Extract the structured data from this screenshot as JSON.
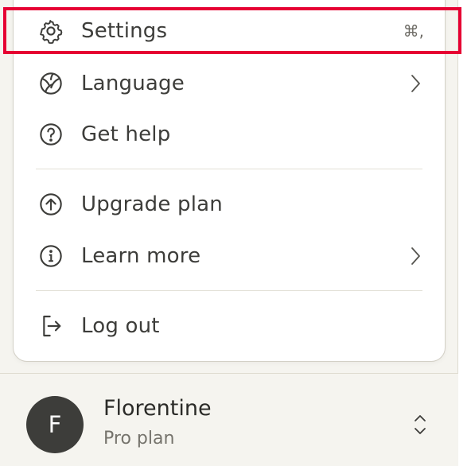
{
  "menu": {
    "settings": {
      "label": "Settings",
      "icon": "gear-icon",
      "shortcut": "⌘,"
    },
    "language": {
      "label": "Language",
      "icon": "globe-icon",
      "chevron": "chevron-right-icon"
    },
    "get_help": {
      "label": "Get help",
      "icon": "question-circle-icon"
    },
    "upgrade_plan": {
      "label": "Upgrade plan",
      "icon": "arrow-up-circle-icon"
    },
    "learn_more": {
      "label": "Learn more",
      "icon": "info-circle-icon",
      "chevron": "chevron-right-icon"
    },
    "log_out": {
      "label": "Log out",
      "icon": "logout-icon"
    }
  },
  "user": {
    "avatar_initial": "F",
    "name": "Florentine",
    "plan": "Pro plan",
    "switcher_icon": "chevron-up-down-icon"
  },
  "colors": {
    "highlight": "#e60033",
    "avatar_bg": "#3d3d3a",
    "text": "#3d3d3a",
    "background": "#f5f4ef"
  }
}
